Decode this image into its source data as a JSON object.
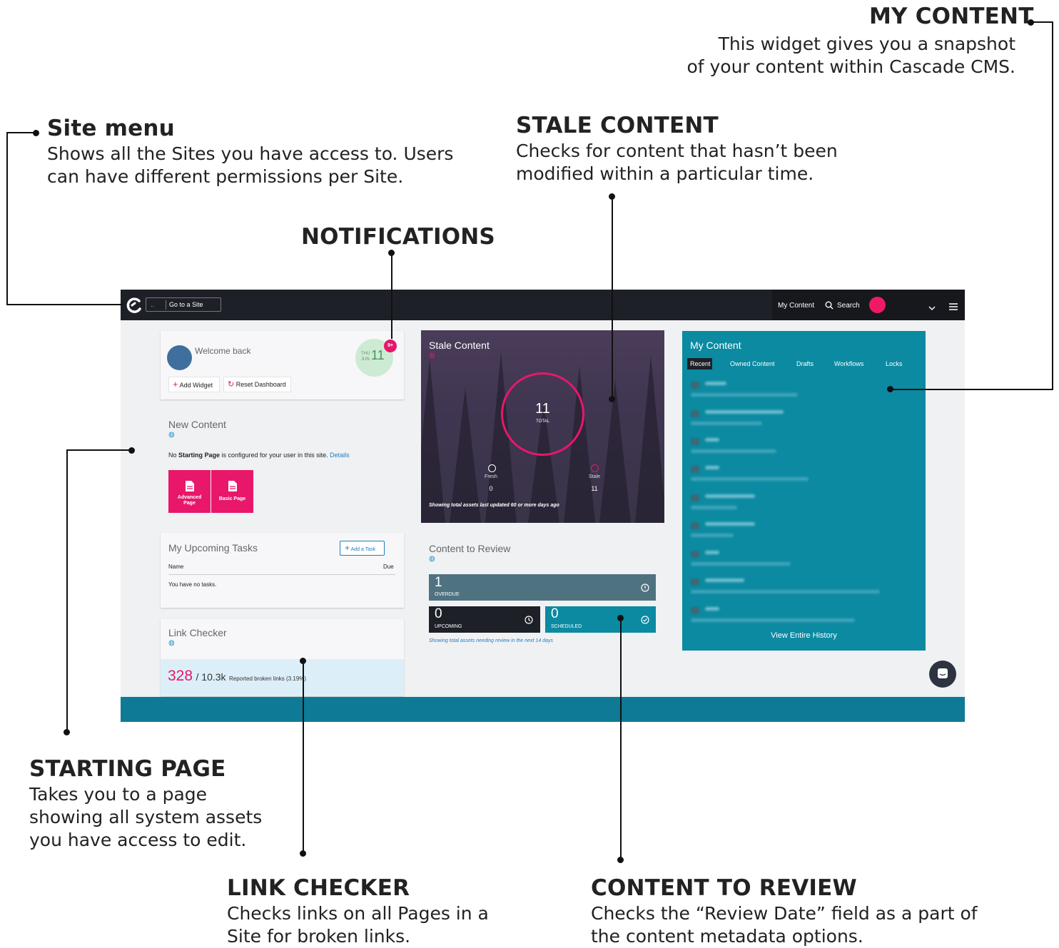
{
  "annotations": {
    "my_content": {
      "title": "MY CONTENT",
      "line1": "This widget gives you a snapshot",
      "line2": "of your content within Cascade CMS."
    },
    "site_menu": {
      "title": "Site menu",
      "line1": "Shows all the Sites you have access to. Users",
      "line2": "can have different permissions per Site."
    },
    "stale_content": {
      "title": "STALE CONTENT",
      "line1": "Checks for content that hasn’t been",
      "line2": "modified within a particular time."
    },
    "notifications": {
      "title": "NOTIFICATIONS"
    },
    "starting_page": {
      "title": "STARTING PAGE",
      "line1": "Takes you to a page",
      "line2": "showing all system assets",
      "line3": "you have access to edit."
    },
    "link_checker": {
      "title": "LINK CHECKER",
      "line1": "Checks links on all Pages in a",
      "line2": "Site for broken links."
    },
    "content_to_review": {
      "title": "CONTENT TO REVIEW",
      "line1": "Checks the “Review Date” field as a part of",
      "line2": "the content metadata options."
    }
  },
  "topbar": {
    "site_prefix": "..",
    "site_label": "Go to a Site",
    "my_content": "My Content",
    "search": "Search"
  },
  "welcome": {
    "text": "Welcome back",
    "day": "THU",
    "month": "JUN",
    "date": "11",
    "notif_badge": "9+",
    "add_widget": "Add Widget",
    "reset_dashboard": "Reset Dashboard"
  },
  "new_content": {
    "title": "New Content",
    "msg_pre": "No ",
    "msg_bold": "Starting Page",
    "msg_post": " is configured for your user in this site. ",
    "details": "Details",
    "btn_advanced_1": "Advanced",
    "btn_advanced_2": "Page",
    "btn_basic": "Basic Page"
  },
  "tasks": {
    "title": "My Upcoming Tasks",
    "add": "Add a Task",
    "col_name": "Name",
    "col_due": "Due",
    "empty": "You have no tasks."
  },
  "link_checker": {
    "title": "Link Checker",
    "broken": "328",
    "total": "/ 10.3k",
    "label": "Reported broken links (3.19%)"
  },
  "stale": {
    "title": "Stale Content",
    "total": "11",
    "total_label": "TOTAL",
    "fresh_label": "Fresh",
    "fresh_value": "0",
    "stale_label": "Stale",
    "stale_value": "11",
    "footnote": "Showing total assets last updated 60 or more days ago",
    "colors": {
      "ring": "#e8176a"
    }
  },
  "review": {
    "title": "Content to Review",
    "overdue_n": "1",
    "overdue_l": "OVERDUE",
    "upcoming_n": "0",
    "upcoming_l": "UPCOMING",
    "scheduled_n": "0",
    "scheduled_l": "SCHEDULED",
    "footnote": "Showing total assets needing review in the next 14 days",
    "colors": {
      "overdue": "#4f7280",
      "upcoming": "#1e2028",
      "scheduled": "#0b8aa1"
    }
  },
  "my_content": {
    "title": "My Content",
    "tabs": [
      "Recent",
      "Owned Content",
      "Drafts",
      "Workflows",
      "Locks"
    ],
    "view_all": "View Entire History"
  },
  "colors": {
    "accent": "#e8176a",
    "teal": "#0b8aa1",
    "dark": "#1e2028"
  }
}
